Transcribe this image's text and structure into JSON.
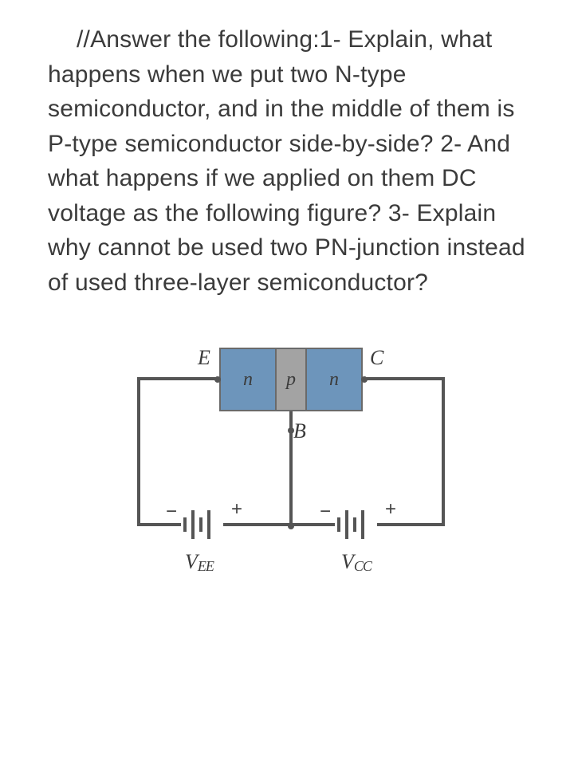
{
  "question": {
    "text": "//Answer the following:1-  Explain, what happens when we put two N-type semiconductor, and in the middle of them is P-type semiconductor side-by-side? 2- And what happens if we applied on them DC voltage as the following figure? 3-   Explain why cannot be used two PN-junction instead of used three-layer semiconductor?"
  },
  "figure": {
    "terminal_E": "E",
    "terminal_C": "C",
    "terminal_B": "B",
    "region_left": "n",
    "region_mid": "p",
    "region_right": "n",
    "minus": "−",
    "plus": "+",
    "VEE_main": "V",
    "VEE_sub": "EE",
    "VCC_main": "V",
    "VCC_sub": "CC"
  }
}
